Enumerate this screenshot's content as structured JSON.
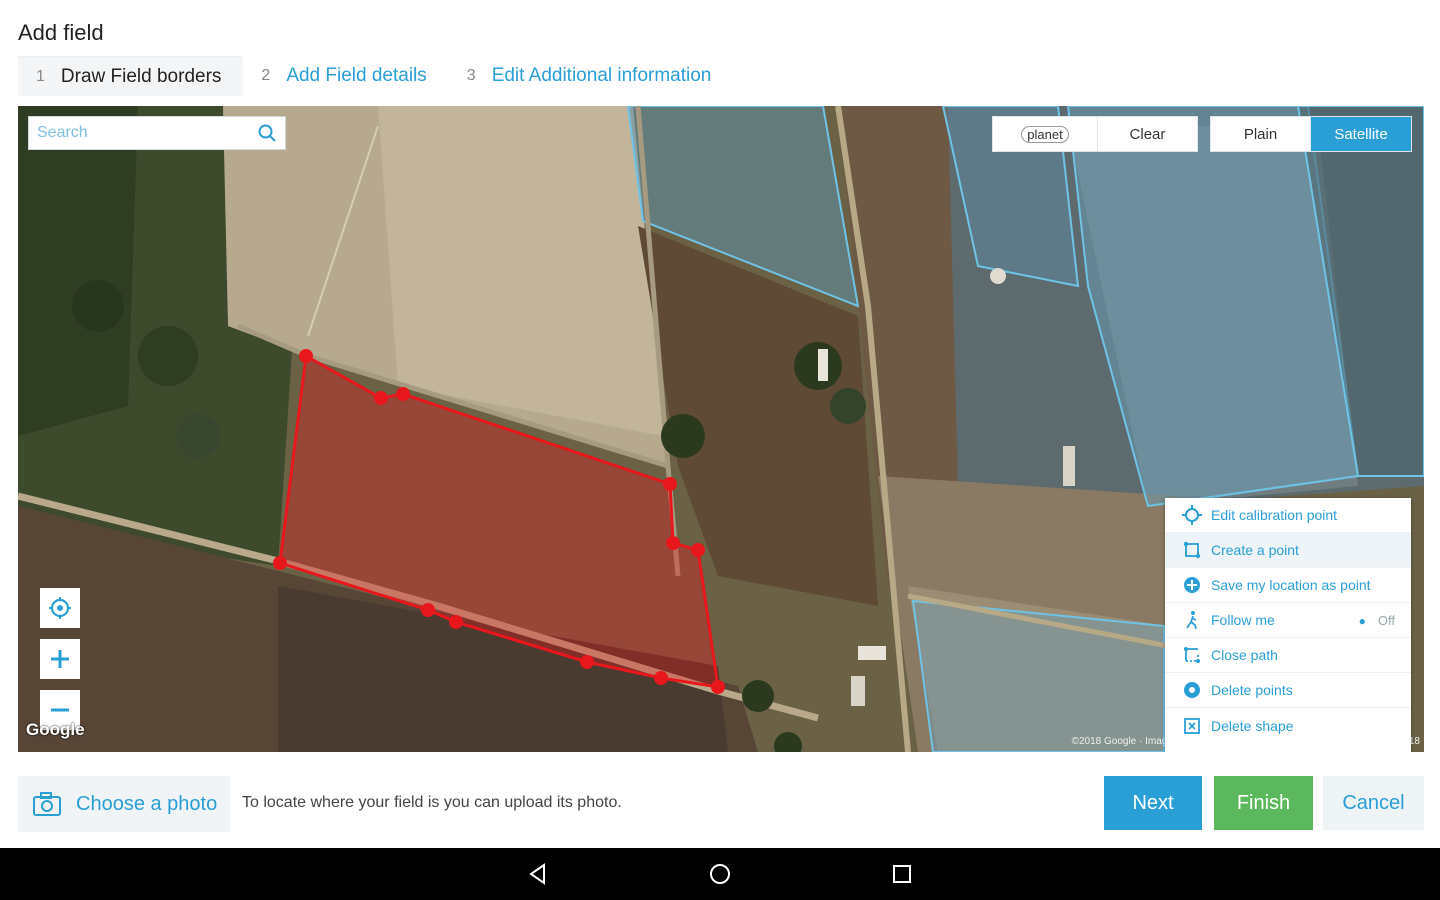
{
  "page": {
    "title": "Add field"
  },
  "steps": [
    {
      "num": "1",
      "label": "Draw Field borders"
    },
    {
      "num": "2",
      "label": "Add Field details"
    },
    {
      "num": "3",
      "label": "Edit Additional information"
    }
  ],
  "map": {
    "search_placeholder": "Search",
    "layer_toggle": {
      "planet": "planet",
      "clear": "Clear"
    },
    "map_type": {
      "plain": "Plain",
      "satellite": "Satellite",
      "selected": "Satellite"
    },
    "google_logo": "Google",
    "attribution": "©2018 Google · Imagery ©2018 DigitalGlobe, CNES / Airbus, Map data ©2018"
  },
  "context_menu": {
    "items": [
      {
        "label": "Edit calibration point",
        "icon": "crosshair-icon"
      },
      {
        "label": "Create a point",
        "icon": "square-dots-icon",
        "selected": true
      },
      {
        "label": "Save my location as point",
        "icon": "plus-circle-icon"
      },
      {
        "label": "Follow me",
        "icon": "walk-icon",
        "state": "Off"
      },
      {
        "label": "Close path",
        "icon": "close-path-icon"
      },
      {
        "label": "Delete points",
        "icon": "delete-points-icon"
      },
      {
        "label": "Delete shape",
        "icon": "delete-shape-icon"
      }
    ]
  },
  "bottom": {
    "photo_button": "Choose a photo",
    "hint": "To locate where your field is you can upload its photo.",
    "next": "Next",
    "finish": "Finish",
    "cancel": "Cancel"
  },
  "colors": {
    "accent": "#2a9fd6",
    "success": "#5cb85c",
    "polygon": "#e8171c"
  }
}
